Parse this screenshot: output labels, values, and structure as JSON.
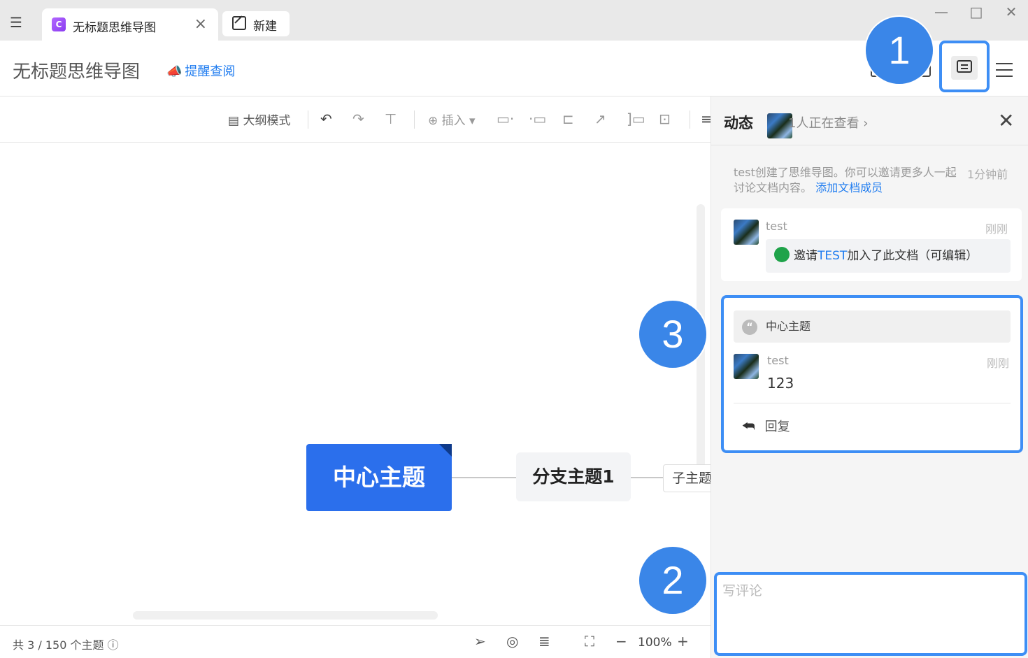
{
  "tabs": {
    "active_label": "无标题思维导图",
    "new_label": "新建"
  },
  "header": {
    "doc_title": "无标题思维导图",
    "remind_label": "提醒查阅"
  },
  "callouts": [
    "1",
    "2",
    "3"
  ],
  "toolbar": {
    "outline_mode": "大纲模式",
    "insert": "插入"
  },
  "mindmap": {
    "central": "中心主题",
    "branch": "分支主题1",
    "sub": "子主题"
  },
  "statusbar": {
    "topic_count": "共 3 / 150 个主题",
    "zoom": "100%"
  },
  "panel": {
    "title": "动态",
    "viewers": "1人正在查看",
    "system_message": {
      "text": "test创建了思维导图。你可以邀请更多人一起讨论文档内容。",
      "link": "添加文档成员",
      "time": "1分钟前"
    },
    "activity": {
      "user": "test",
      "time": "刚刚",
      "invite_prefix": "邀请",
      "invite_target": "TEST",
      "invite_suffix": "加入了此文档（可编辑）"
    },
    "comment": {
      "quote": "中心主题",
      "user": "test",
      "time": "刚刚",
      "text": "123",
      "reply_label": "回复"
    },
    "input_placeholder": "写评论"
  },
  "colors": {
    "accent": "#2b6fec",
    "callout": "#3a86e8",
    "link": "#1f7cf0"
  }
}
